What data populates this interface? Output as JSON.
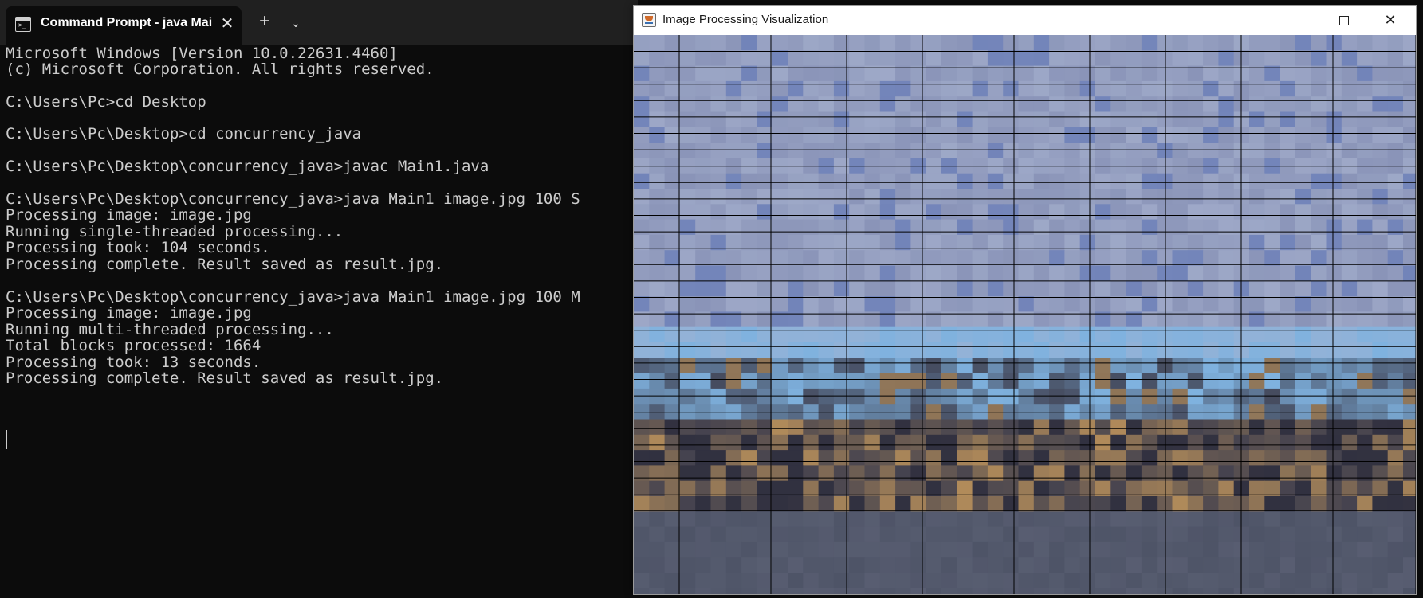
{
  "terminal": {
    "tab_title": "Command Prompt - java  Mai",
    "tab_icon": "cmd-icon",
    "close_icon": "close-icon",
    "new_tab_icon": "plus-icon",
    "dropdown_icon": "chevron-down-icon",
    "lines": [
      "Microsoft Windows [Version 10.0.22631.4460]",
      "(c) Microsoft Corporation. All rights reserved.",
      "",
      "C:\\Users\\Pc>cd Desktop",
      "",
      "C:\\Users\\Pc\\Desktop>cd concurrency_java",
      "",
      "C:\\Users\\Pc\\Desktop\\concurrency_java>javac Main1.java",
      "",
      "C:\\Users\\Pc\\Desktop\\concurrency_java>java Main1 image.jpg 100 S",
      "Processing image: image.jpg",
      "Running single-threaded processing...",
      "Processing took: 104 seconds.",
      "Processing complete. Result saved as result.jpg.",
      "",
      "C:\\Users\\Pc\\Desktop\\concurrency_java>java Main1 image.jpg 100 M",
      "Processing image: image.jpg",
      "Running multi-threaded processing...",
      "Total blocks processed: 1664",
      "Processing took: 13 seconds.",
      "Processing complete. Result saved as result.jpg."
    ]
  },
  "viz_window": {
    "title": "Image Processing Visualization",
    "app_icon": "java-icon",
    "minimize_icon": "minimize-icon",
    "maximize_icon": "maximize-icon",
    "close_icon": "close-icon",
    "colors": {
      "sky_top": "#8a94b8",
      "sky_light": "#a7b2cf",
      "sky_blue": "#7fb2df",
      "city_dark": "#3e3e4e",
      "city_warm": "#b18b5a",
      "ground": "#4e5467",
      "grid_line": "#000000"
    }
  }
}
